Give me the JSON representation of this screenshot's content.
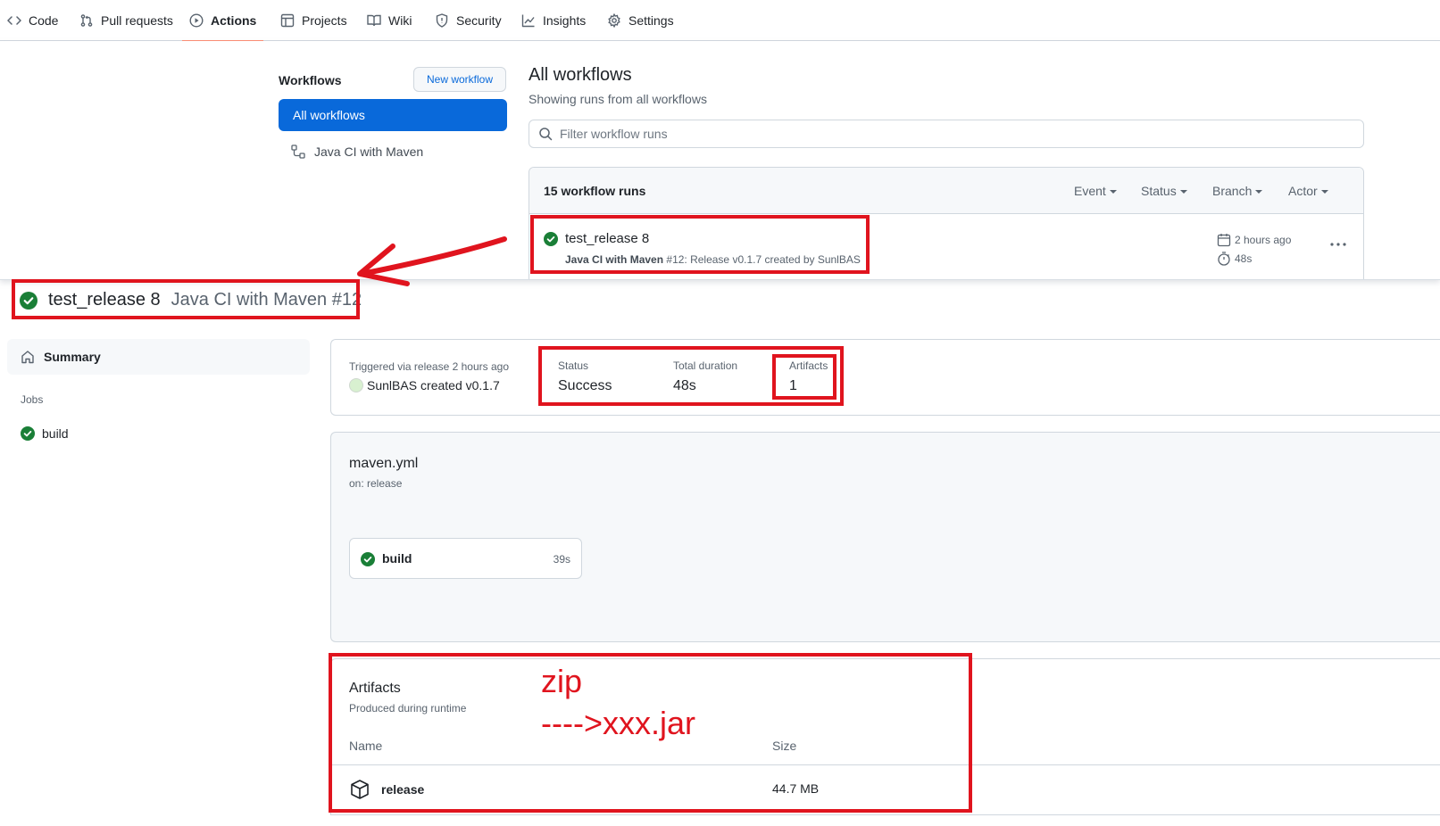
{
  "nav": {
    "tabs": [
      {
        "label": "Code",
        "icon": "code-icon"
      },
      {
        "label": "Pull requests",
        "icon": "git-pull-request-icon"
      },
      {
        "label": "Actions",
        "icon": "play-icon",
        "active": true
      },
      {
        "label": "Projects",
        "icon": "table-icon"
      },
      {
        "label": "Wiki",
        "icon": "book-icon"
      },
      {
        "label": "Security",
        "icon": "shield-icon"
      },
      {
        "label": "Insights",
        "icon": "graph-icon"
      },
      {
        "label": "Settings",
        "icon": "gear-icon"
      }
    ]
  },
  "workflows_panel": {
    "heading": "Workflows",
    "new_button": "New workflow",
    "items": [
      {
        "label": "All workflows",
        "selected": true
      },
      {
        "label": "Java CI with Maven",
        "icon": "workflow-icon"
      }
    ]
  },
  "runs_view": {
    "title": "All workflows",
    "subtitle": "Showing runs from all workflows",
    "filter_placeholder": "Filter workflow runs",
    "count_label": "15 workflow runs",
    "filters": [
      "Event",
      "Status",
      "Branch",
      "Actor"
    ],
    "run": {
      "title": "test_release 8",
      "workflow": "Java CI with Maven",
      "meta": "#12: Release v0.1.7 created by SunlBAS",
      "time": "2 hours ago",
      "duration": "48s",
      "status": "success"
    }
  },
  "run_detail": {
    "title": "test_release 8",
    "subtitle": "Java CI with Maven #12",
    "sidebar": {
      "summary_label": "Summary",
      "jobs_label": "Jobs",
      "jobs": [
        {
          "label": "build",
          "status": "success"
        }
      ]
    },
    "trigger": {
      "label": "Triggered via release 2 hours ago",
      "user": "SunlBAS",
      "action": "created v0.1.7"
    },
    "stats": [
      {
        "label": "Status",
        "value": "Success"
      },
      {
        "label": "Total duration",
        "value": "48s"
      },
      {
        "label": "Artifacts",
        "value": "1"
      }
    ],
    "workflow_file": {
      "name": "maven.yml",
      "trigger": "on: release",
      "job": {
        "name": "build",
        "duration": "39s"
      }
    },
    "artifacts": {
      "title": "Artifacts",
      "subtitle": "Produced during runtime",
      "col_name": "Name",
      "col_size": "Size",
      "rows": [
        {
          "name": "release",
          "size": "44.7 MB",
          "icon": "package-icon"
        }
      ]
    }
  },
  "annotations": {
    "line1": "zip",
    "line2": "---->xxx.jar",
    "color": "#e0141e"
  },
  "colors": {
    "accent": "#0969da",
    "success": "#1a7f37",
    "active_tab_underline": "#fd8c73"
  }
}
